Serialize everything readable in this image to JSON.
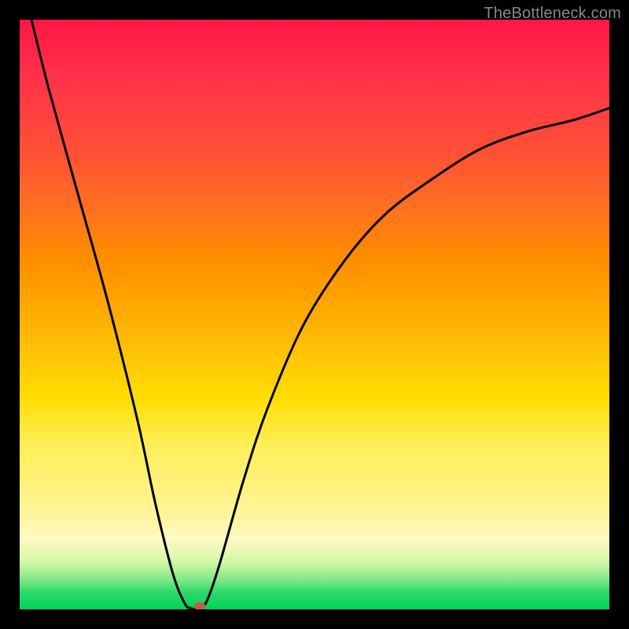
{
  "watermark": "TheBottleneck.com",
  "chart_data": {
    "type": "line",
    "title": "",
    "xlabel": "",
    "ylabel": "",
    "xlim": [
      0,
      100
    ],
    "ylim": [
      0,
      100
    ],
    "series": [
      {
        "name": "bottleneck-curve",
        "x": [
          2,
          5,
          10,
          15,
          20,
          23,
          26,
          28,
          29,
          30,
          31,
          32,
          34,
          38,
          42,
          48,
          55,
          62,
          70,
          78,
          86,
          94,
          100
        ],
        "y": [
          100,
          88,
          70,
          52,
          32,
          18,
          6,
          1,
          0.2,
          0,
          0.5,
          2,
          8,
          22,
          34,
          48,
          59,
          67,
          73,
          78,
          81,
          83,
          85
        ]
      }
    ],
    "marker": {
      "x": 30.5,
      "y": 0
    },
    "gradient_stops": [
      {
        "pos": 0,
        "color": "#ff1744"
      },
      {
        "pos": 50,
        "color": "#ffc400"
      },
      {
        "pos": 88,
        "color": "#fff9b0"
      },
      {
        "pos": 100,
        "color": "#00d455"
      }
    ]
  }
}
